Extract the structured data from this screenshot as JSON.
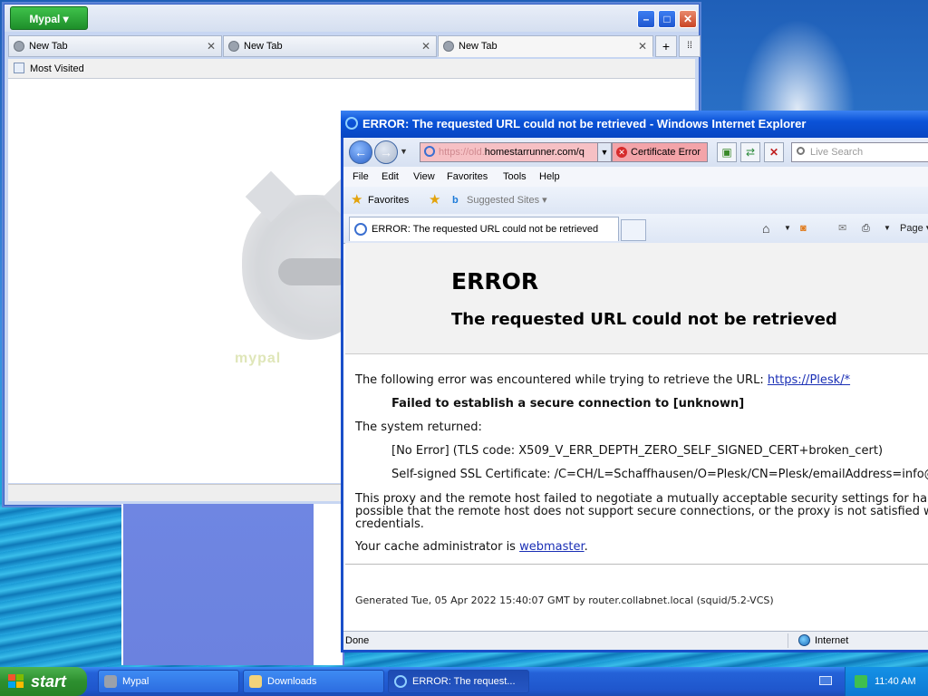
{
  "mypal_window": {
    "menu_button": "Mypal ▾",
    "tabs": [
      {
        "label": "New Tab",
        "close": "✕"
      },
      {
        "label": "New Tab",
        "close": "✕"
      },
      {
        "label": "New Tab",
        "close": "✕"
      }
    ],
    "new_tab_glyph": "+",
    "tab_list_glyph": "⁞⁞",
    "bookmarks_toolbar": {
      "most_visited": "Most Visited"
    },
    "logo_text": "mypal"
  },
  "ie_window": {
    "title": "ERROR: The requested URL could not be retrieved - Windows Internet Explorer",
    "address": {
      "scheme_prefix": "https://old.",
      "host": "homestarrunner.com/q"
    },
    "certificate_error": "Certificate Error",
    "search_placeholder": "Live Search",
    "menu": [
      "File",
      "Edit",
      "View",
      "Favorites",
      "Tools",
      "Help"
    ],
    "favorites_label": "Favorites",
    "suggested_sites": "Suggested Sites ▾",
    "tab_title": "ERROR: The requested URL could not be retrieved",
    "command_page": "Page ▾",
    "page": {
      "h1": "ERROR",
      "h2": "The requested URL could not be retrieved",
      "line1_text": "The following error was encountered while trying to retrieve the URL: ",
      "line1_link": "https://Plesk/*",
      "failed": "Failed to establish a secure connection to [unknown]",
      "system_returned": "The system returned:",
      "no_error": "[No Error] (TLS code: X509_V_ERR_DEPTH_ZERO_SELF_SIGNED_CERT+broken_cert)",
      "self_signed": "Self-signed SSL Certificate: /C=CH/L=Schaffhausen/O=Plesk/CN=Plesk/emailAddress=info@ple",
      "proxy_para": [
        "This proxy and the remote host failed to negotiate a mutually acceptable security settings for handlin",
        "possible that the remote host does not support secure connections, or the proxy is not satisfied with",
        "credentials."
      ],
      "cache_admin_text": "Your cache administrator is ",
      "cache_admin_link": "webmaster",
      "cache_admin_end": ".",
      "generated": "Generated Tue, 05 Apr 2022 15:40:07 GMT by router.collabnet.local (squid/5.2-VCS)"
    },
    "status_left": "Done",
    "status_zone": "Internet"
  },
  "taskbar": {
    "start": "start",
    "tasks": [
      {
        "label": "Mypal"
      },
      {
        "label": "Downloads"
      },
      {
        "label": "ERROR: The request..."
      }
    ],
    "clock": "11:40 AM"
  },
  "colors": {
    "xp_blue_title": "#0a52d8",
    "start_green": "#2d8f2f",
    "certificate_error_bg": "#f3a4a9",
    "link_blue": "#1a2fb5"
  }
}
